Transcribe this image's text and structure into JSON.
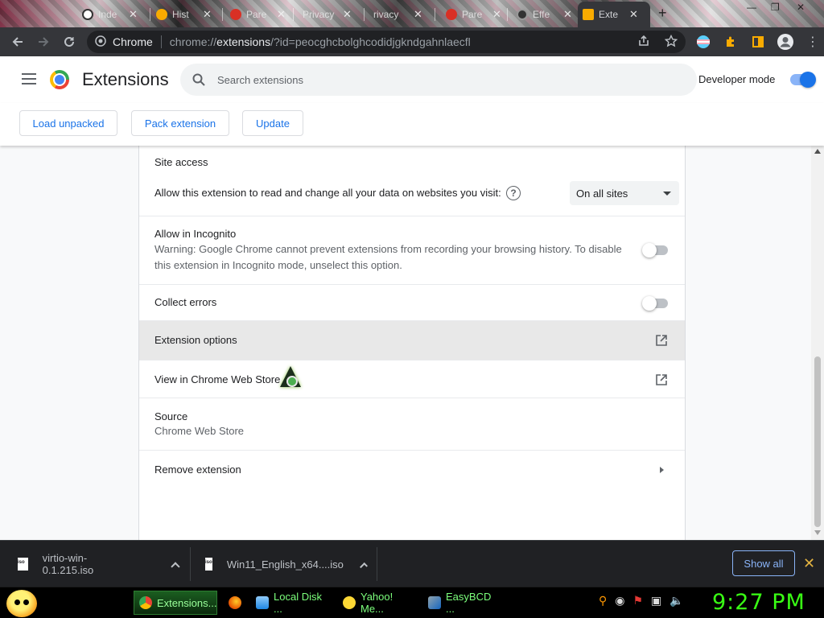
{
  "browser": {
    "tabs": [
      {
        "title": "Inde",
        "favicon_color": "#ffffff"
      },
      {
        "title": "Hist",
        "favicon_color": "#f9ab00"
      },
      {
        "title": "Pare",
        "favicon_color": "#d93025"
      },
      {
        "title": "Privacy",
        "favicon_color": "#888888"
      },
      {
        "title": "rivacy",
        "favicon_color": "#888888"
      },
      {
        "title": "Pare",
        "favicon_color": "#d93025"
      },
      {
        "title": "Effe",
        "favicon_color": "#333333"
      },
      {
        "title": "Exte",
        "favicon_color": "#f9ab00"
      }
    ],
    "omnibox": {
      "chip": "Chrome",
      "url_prefix": "chrome://",
      "url_host": "extensions",
      "url_rest": "/?id=peocghcbolghcodidjgkndgahnlaecfl"
    }
  },
  "header": {
    "title": "Extensions",
    "search_placeholder": "Search extensions",
    "developer_mode_label": "Developer mode",
    "developer_mode_on": true
  },
  "toolbar": {
    "load_unpacked": "Load unpacked",
    "pack_extension": "Pack extension",
    "update": "Update"
  },
  "details": {
    "site_access": {
      "title": "Site access",
      "description": "Allow this extension to read and change all your data on websites you visit:",
      "help": "?",
      "selected": "On all sites"
    },
    "incognito": {
      "title": "Allow in Incognito",
      "warning_line1": "Warning: Google Chrome cannot prevent extensions from recording your browsing history. To disable",
      "warning_line2": "this extension in Incognito mode, unselect this option.",
      "enabled": false
    },
    "collect_errors": {
      "title": "Collect errors",
      "enabled": false
    },
    "extension_options": "Extension options",
    "web_store": "View in Chrome Web Store",
    "source": {
      "title": "Source",
      "value": "Chrome Web Store"
    },
    "remove": "Remove extension"
  },
  "downloads": {
    "items": [
      {
        "name": "virtio-win-0.1.215.iso"
      },
      {
        "name": "Win11_English_x64....iso"
      }
    ],
    "show_all": "Show all"
  },
  "taskbar": {
    "items": [
      {
        "label": "Extensions...",
        "icon": "chrome-icon",
        "active": true
      },
      {
        "label": "",
        "icon": "firefox-icon",
        "active": false
      },
      {
        "label": "Local Disk ...",
        "icon": "folder-icon",
        "active": false
      },
      {
        "label": "Yahoo! Me...",
        "icon": "yahoo-messenger-icon",
        "active": false
      },
      {
        "label": "EasyBCD ...",
        "icon": "easybcd-icon",
        "active": false
      }
    ],
    "clock": "9:27 PM"
  },
  "colors": {
    "accent": "#1a73e8",
    "clock_green": "#39ff14",
    "taskbar_text": "#7cff7c"
  }
}
